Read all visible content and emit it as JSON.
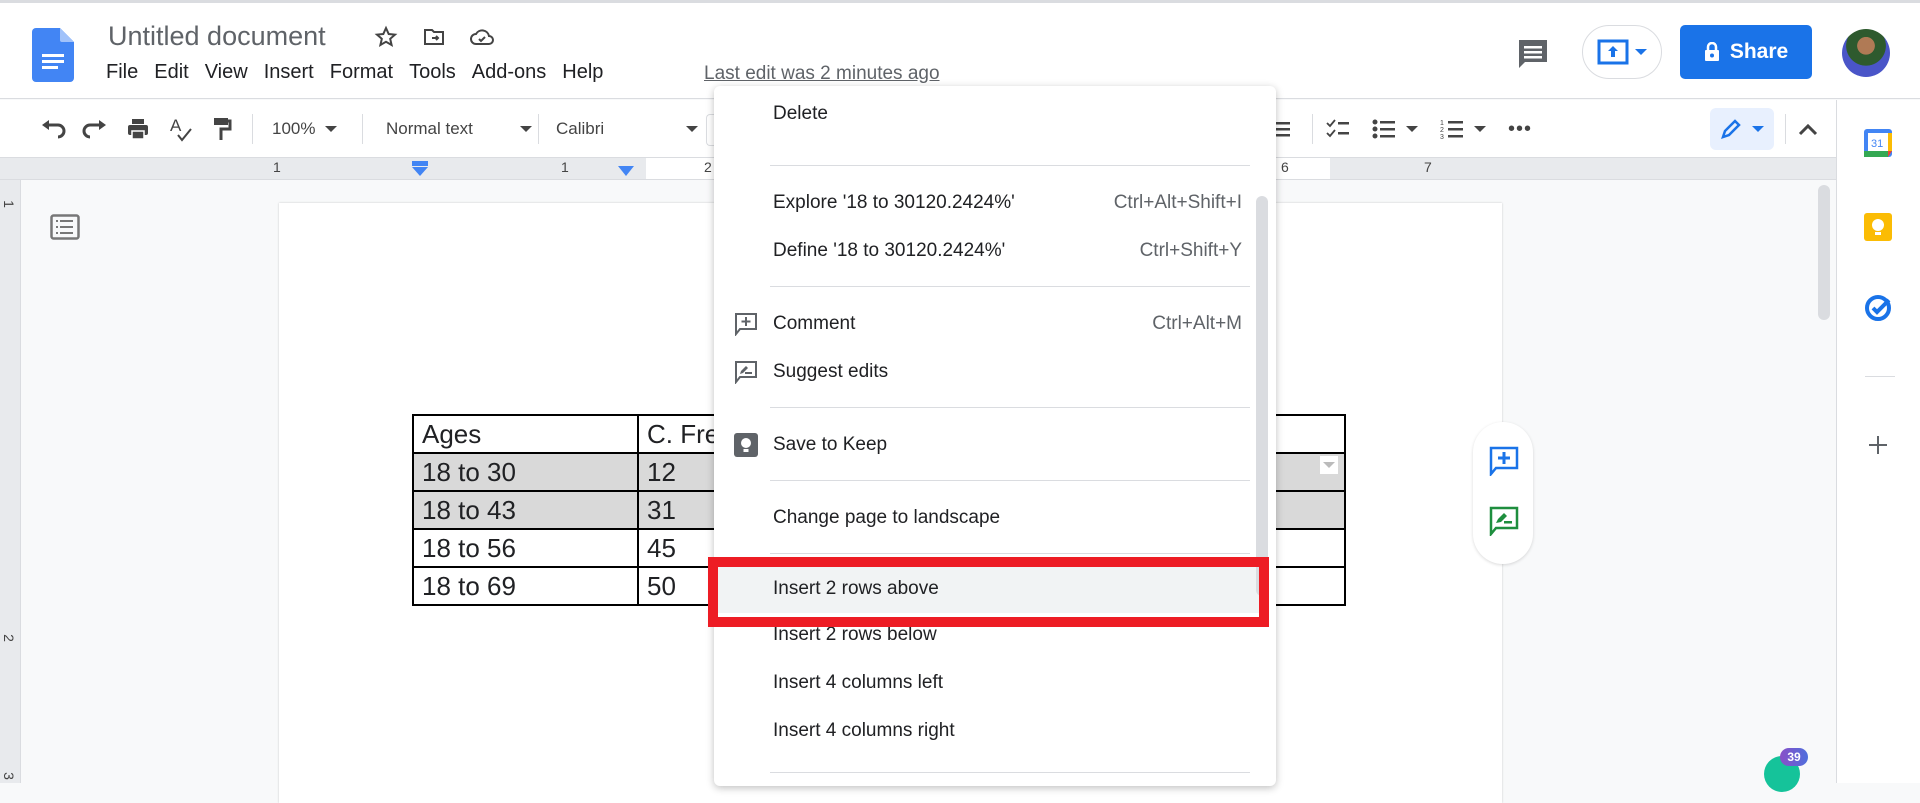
{
  "header": {
    "title": "Untitled document",
    "icons": [
      "star-icon",
      "move-to-folder-icon",
      "cloud-saved-icon"
    ],
    "menu": [
      "File",
      "Edit",
      "View",
      "Insert",
      "Format",
      "Tools",
      "Add-ons",
      "Help"
    ],
    "last_edit": "Last edit was 2 minutes ago",
    "share_label": "Share"
  },
  "toolbar": {
    "zoom": "100%",
    "style": "Normal text",
    "font": "Calibri"
  },
  "ruler": {
    "h_labels": [
      "1",
      "1",
      "2",
      "6",
      "7"
    ],
    "v_labels": [
      "1",
      "2",
      "3"
    ]
  },
  "table": {
    "rows": [
      {
        "c1": "Ages",
        "c2": "C. Fre",
        "selected": false
      },
      {
        "c1": "18 to 30",
        "c2": "12",
        "selected": true
      },
      {
        "c1": "18 to 43",
        "c2": "31",
        "selected": true
      },
      {
        "c1": "18 to 56",
        "c2": "45",
        "selected": false
      },
      {
        "c1": "18 to 69",
        "c2": "50",
        "selected": false
      }
    ]
  },
  "context_menu": {
    "items": [
      {
        "label": "Delete",
        "shortcut": ""
      },
      {
        "label": "Explore '18 to 30120.2424%'",
        "shortcut": "Ctrl+Alt+Shift+I"
      },
      {
        "label": "Define '18 to 30120.2424%'",
        "shortcut": "Ctrl+Shift+Y"
      },
      {
        "label": "Comment",
        "shortcut": "Ctrl+Alt+M",
        "icon": "add-comment-icon"
      },
      {
        "label": "Suggest edits",
        "shortcut": "",
        "icon": "suggest-edits-icon"
      },
      {
        "label": "Save to Keep",
        "shortcut": "",
        "icon": "keep-icon"
      },
      {
        "label": "Change page to landscape",
        "shortcut": ""
      },
      {
        "label": "Insert 2 rows above",
        "shortcut": "",
        "highlighted": true
      },
      {
        "label": "Insert 2 rows below",
        "shortcut": ""
      },
      {
        "label": "Insert 4 columns left",
        "shortcut": ""
      },
      {
        "label": "Insert 4 columns right",
        "shortcut": ""
      }
    ]
  },
  "side_panel": {
    "calendar_day": "31"
  },
  "grammarly": {
    "count": "39"
  },
  "colors": {
    "accent": "#1a73e8",
    "highlight_box": "#ed1c24",
    "selected_cell": "#d9d9d9"
  }
}
